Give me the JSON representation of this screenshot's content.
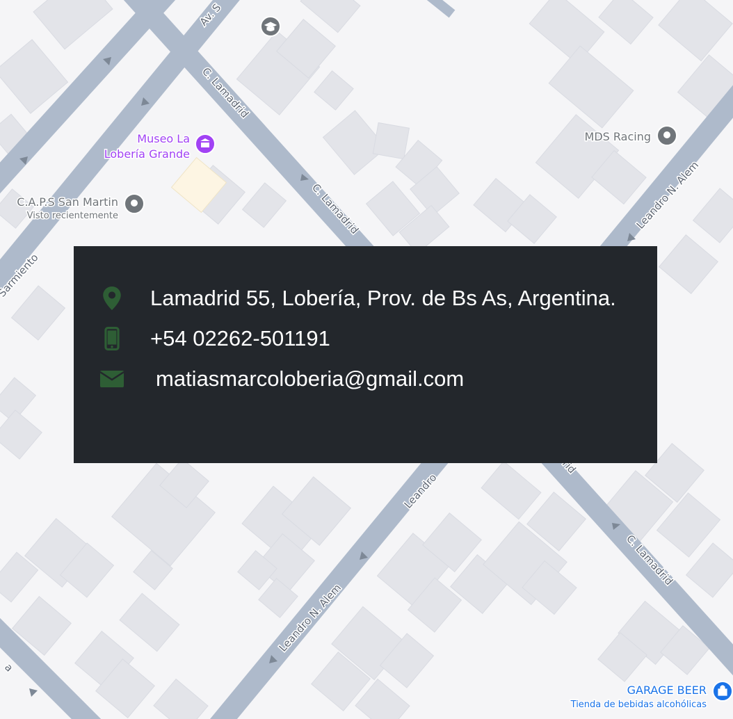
{
  "colors": {
    "map_background": "#f5f5f7",
    "road": "#aebacb",
    "building": "#e3e4e9",
    "building_edge": "#d9dbe2",
    "park": "#fdf5e3",
    "panel_background": "#23272c",
    "panel_text": "#ffffff",
    "icon_green": "#2e5e35",
    "poi_gray": "#70757a",
    "poi_purple": "#a142f4",
    "poi_blue": "#1a73e8"
  },
  "map": {
    "streets": {
      "sarmiento": "Sarmiento",
      "av_top": "Av. S",
      "lamadrid_1": "C. Lamadrid",
      "lamadrid_2": "C. Lamadrid",
      "lamadrid_3": "C. Lamadrid",
      "lamadrid_stub": "rid",
      "alem_1": "Leandro N. Alem",
      "alem_2": "Leandro N. Alem",
      "alem_stub": "Leandro",
      "left_bottom_stub": "a"
    },
    "pois": {
      "museo": {
        "name_line1": "Museo La",
        "name_line2": "Lobería Grande",
        "icon": "museum-icon"
      },
      "caps": {
        "name": "C.A.P.S San Martin",
        "subtitle": "Visto recientemente",
        "icon": "place-pin-icon"
      },
      "mds": {
        "name": "MDS Racing",
        "icon": "place-pin-icon"
      },
      "school": {
        "icon": "school-icon"
      },
      "garage": {
        "name": "GARAGE BEER",
        "subtitle": "Tienda de bebidas alcohólicas",
        "icon": "shopping-bag-icon"
      }
    }
  },
  "contact": {
    "address": {
      "icon": "location-pin-icon",
      "text": "Lamadrid 55, Lobería, Prov. de Bs As, Argentina."
    },
    "phone": {
      "icon": "mobile-phone-icon",
      "text": "+54 02262-501191"
    },
    "email": {
      "icon": "envelope-icon",
      "text": "matiasmarcoloberia@gmail.com"
    }
  }
}
